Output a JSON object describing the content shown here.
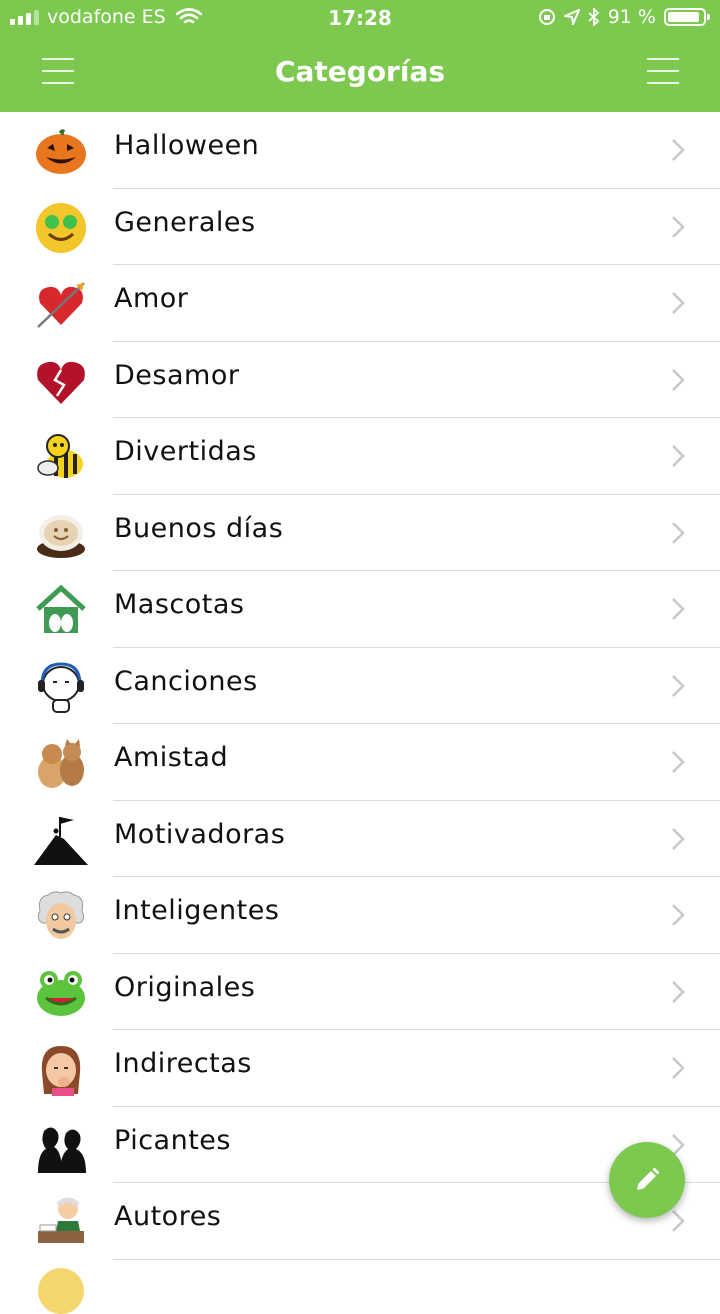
{
  "status_bar": {
    "carrier": "vodafone ES",
    "time": "17:28",
    "battery_percent": "91 %",
    "battery_level": 0.91
  },
  "nav": {
    "title": "Categorías",
    "left_icon": "menu-icon",
    "right_icon": "menu-icon"
  },
  "categories": [
    {
      "label": "Halloween",
      "icon": "pumpkin-icon"
    },
    {
      "label": "Generales",
      "icon": "smiley-whatsapp-icon"
    },
    {
      "label": "Amor",
      "icon": "heart-arrow-icon"
    },
    {
      "label": "Desamor",
      "icon": "broken-heart-icon"
    },
    {
      "label": "Divertidas",
      "icon": "bee-icon"
    },
    {
      "label": "Buenos días",
      "icon": "coffee-cup-icon"
    },
    {
      "label": "Mascotas",
      "icon": "pet-house-icon"
    },
    {
      "label": "Canciones",
      "icon": "headphones-character-icon"
    },
    {
      "label": "Amistad",
      "icon": "dog-cat-icon"
    },
    {
      "label": "Motivadoras",
      "icon": "mountain-flag-icon"
    },
    {
      "label": "Inteligentes",
      "icon": "einstein-icon"
    },
    {
      "label": "Originales",
      "icon": "frog-icon"
    },
    {
      "label": "Indirectas",
      "icon": "woman-thinking-icon"
    },
    {
      "label": "Picantes",
      "icon": "couple-kiss-icon"
    },
    {
      "label": "Autores",
      "icon": "writer-icon"
    }
  ],
  "fab": {
    "icon": "pencil-icon"
  },
  "colors": {
    "accent": "#7dc950",
    "separator": "#dcdcdc",
    "chevron": "#c7c7cc"
  }
}
